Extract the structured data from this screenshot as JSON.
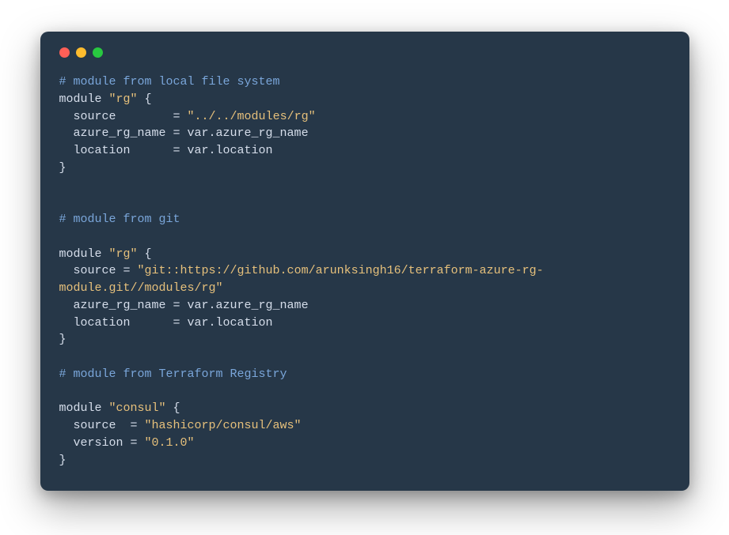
{
  "traffic": {
    "red": "#ff5f57",
    "yellow": "#febc2e",
    "green": "#28c840"
  },
  "code": {
    "c1": "# module from local file system",
    "l2a": "module ",
    "l2b": "\"rg\"",
    "l2c": " {",
    "l3a": "  source        = ",
    "l3b": "\"../../modules/rg\"",
    "l4a": "  azure_rg_name = var.azure_rg_name",
    "l5a": "  location      = var.location",
    "l6a": "}",
    "c2": "# module from git",
    "l8a": "module ",
    "l8b": "\"rg\"",
    "l8c": " {",
    "l9a": "  source = ",
    "l9b": "\"git::https://github.com/arunksingh16/terraform-azure-rg-module.git//modules/rg\"",
    "l10a": "  azure_rg_name = var.azure_rg_name",
    "l11a": "  location      = var.location",
    "l12a": "}",
    "c3": "# module from Terraform Registry",
    "l14a": "module ",
    "l14b": "\"consul\"",
    "l14c": " {",
    "l15a": "  source  = ",
    "l15b": "\"hashicorp/consul/aws\"",
    "l16a": "  version = ",
    "l16b": "\"0.1.0\"",
    "l17a": "}"
  }
}
